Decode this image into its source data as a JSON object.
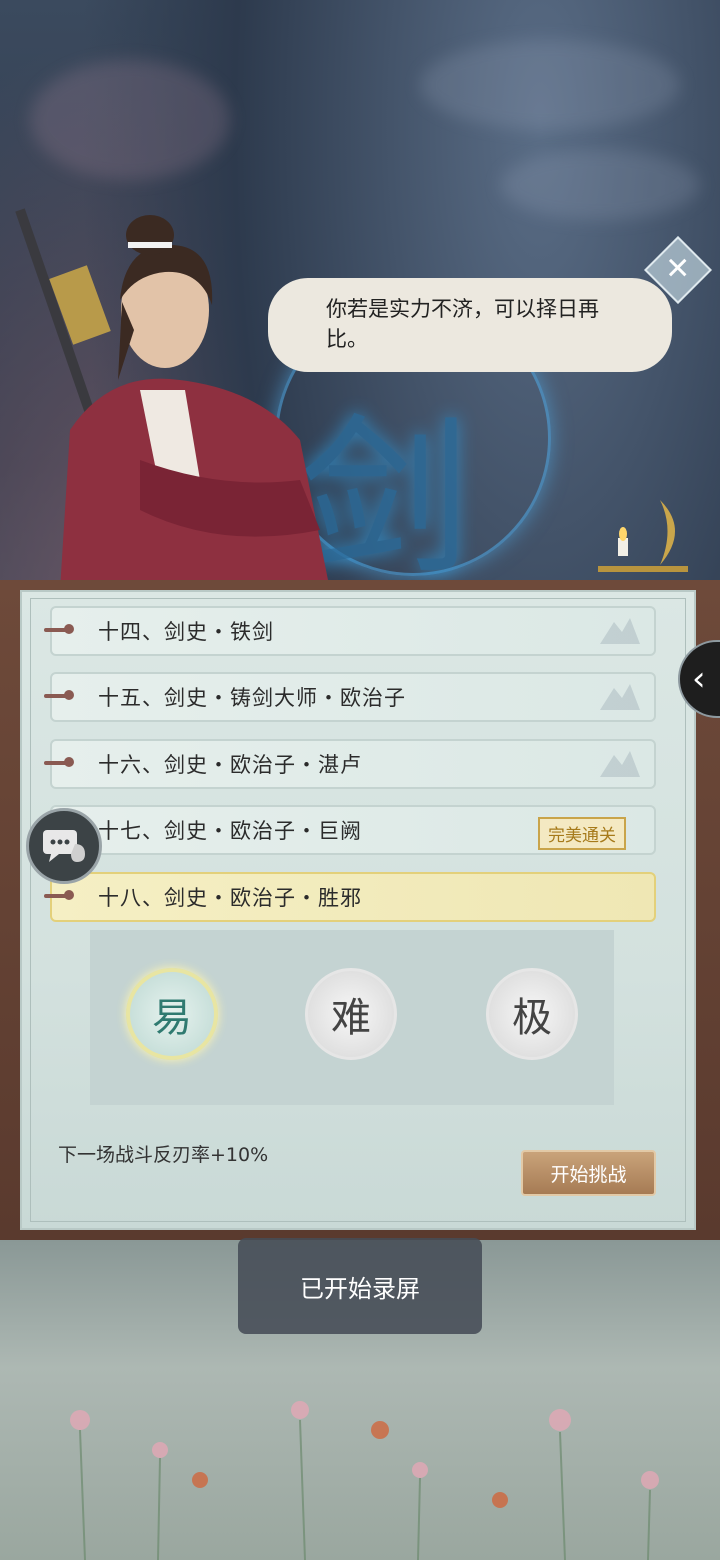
{
  "dialogue": {
    "text": "你若是实力不济，可以择日再比。"
  },
  "background": {
    "glyph": "剑"
  },
  "stages": [
    {
      "label": "十四、剑史・铁剑",
      "badge": ""
    },
    {
      "label": "十五、剑史・铸剑大师・欧治子",
      "badge": ""
    },
    {
      "label": "十六、剑史・欧治子・湛卢",
      "badge": ""
    },
    {
      "label": "十七、剑史・欧治子・巨阙",
      "badge": "完美通关"
    },
    {
      "label": "十八、剑史・欧治子・胜邪",
      "badge": "",
      "selected": true
    }
  ],
  "difficulty": {
    "options": [
      {
        "label": "易",
        "selected": true
      },
      {
        "label": "难",
        "selected": false
      },
      {
        "label": "极",
        "selected": false
      }
    ]
  },
  "buff_text": "下一场战斗反刃率+10%",
  "start_button": {
    "label": "开始挑战"
  },
  "toast": {
    "text": "已开始录屏"
  },
  "icons": {
    "close": "close-icon",
    "side_tab": "chevron-left-icon",
    "chat": "chat-bubble-icon"
  },
  "colors": {
    "selected_stage": "#f5efc4",
    "start_button": "#b68c64",
    "pin": "#8a5a52"
  }
}
